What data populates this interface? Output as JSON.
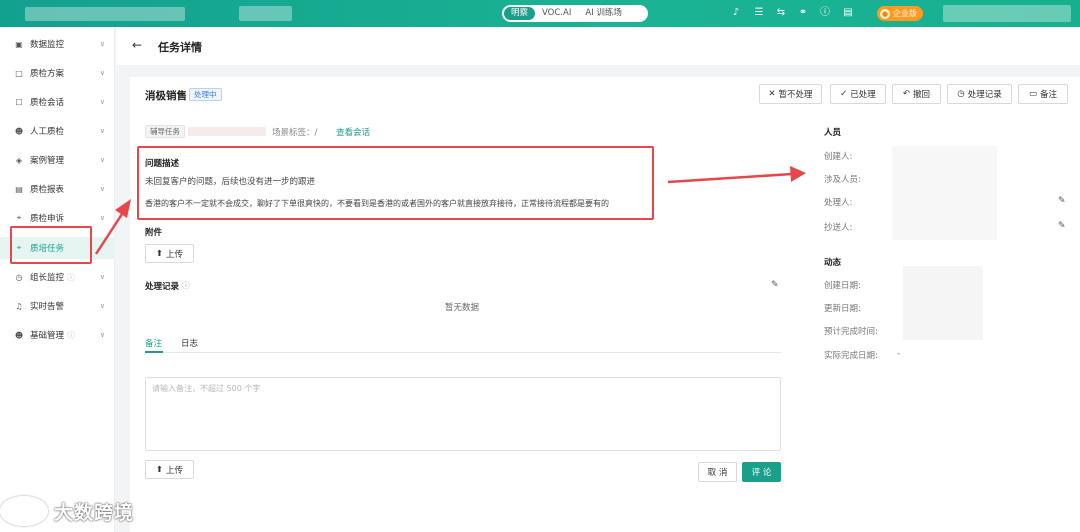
{
  "topbar": {
    "tabs": [
      "明察",
      "VOC.AI",
      "AI 训练场"
    ],
    "active_tab": 0,
    "enterprise_badge": "企业版"
  },
  "sidebar": {
    "items": [
      {
        "label": "数据监控",
        "icon": "dashboard-icon"
      },
      {
        "label": "质检方案",
        "icon": "document-icon"
      },
      {
        "label": "质检会话",
        "icon": "chat-icon"
      },
      {
        "label": "人工质检",
        "icon": "user-icon"
      },
      {
        "label": "案例管理",
        "icon": "layers-icon"
      },
      {
        "label": "质检报表",
        "icon": "report-icon"
      },
      {
        "label": "质检申诉",
        "icon": "appeal-icon"
      },
      {
        "label": "质培任务",
        "icon": "task-icon"
      },
      {
        "label": "组长监控",
        "icon": "clock-icon"
      },
      {
        "label": "实时告警",
        "icon": "bell-icon"
      },
      {
        "label": "基础管理",
        "icon": "user-settings-icon"
      }
    ],
    "active_index": 7
  },
  "page": {
    "back": "←",
    "title": "任务详情"
  },
  "task": {
    "name": "消极销售",
    "status": "处理中",
    "type_tag": "辅导任务",
    "scene_label": "场景标签：/",
    "view_session": "查看会话"
  },
  "actions": [
    "暂不处理",
    "已处理",
    "撤回",
    "处理记录",
    "备注"
  ],
  "problem": {
    "heading": "问题描述",
    "line1": "未回复客户的问题，后续也没有进一步的跟进",
    "line2": "香港的客户不一定就不会成交，聊好了下单很爽快的，不要看到是香港的或者国外的客户就直接放弃接待，正常接待流程都是要有的"
  },
  "attachments": {
    "heading": "附件",
    "upload": "上传"
  },
  "records": {
    "heading": "处理记录",
    "empty": "暂无数据"
  },
  "comment_tabs": [
    "备注",
    "日志"
  ],
  "comment": {
    "placeholder": "请输入备注，不超过 500 个字",
    "upload": "上传",
    "cancel": "取 消",
    "submit": "评 论"
  },
  "people": {
    "heading": "人员",
    "labels": [
      "创建人:",
      "涉及人员:",
      "处理人:",
      "抄送人:"
    ]
  },
  "activity": {
    "heading": "动态",
    "labels": [
      "创建日期:",
      "更新日期:",
      "预计完成时间:",
      "实际完成日期:"
    ],
    "actual_done": "-"
  },
  "watermark": "大数跨境"
}
